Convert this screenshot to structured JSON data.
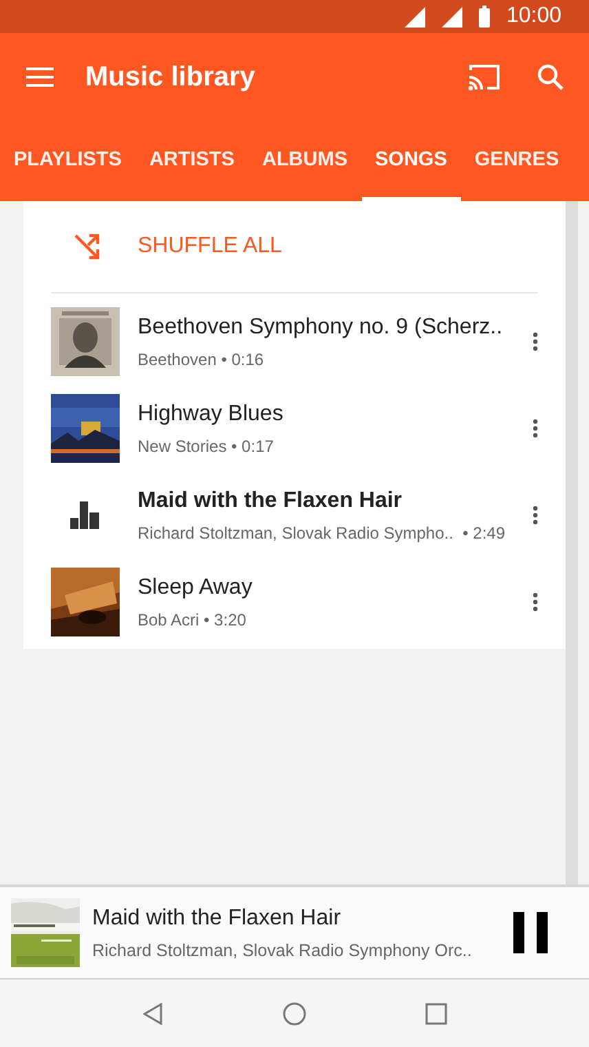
{
  "status_bar": {
    "time": "10:00"
  },
  "toolbar": {
    "title": "Music library"
  },
  "tabs": [
    {
      "label": "PLAYLISTS",
      "selected": false
    },
    {
      "label": "ARTISTS",
      "selected": false
    },
    {
      "label": "ALBUMS",
      "selected": false
    },
    {
      "label": "SONGS",
      "selected": true
    },
    {
      "label": "GENRES",
      "selected": false
    }
  ],
  "shuffle": {
    "label": "SHUFFLE ALL"
  },
  "songs": [
    {
      "title": "Beethoven Symphony no. 9 (Scherz..",
      "subtitle": "Beethoven • 0:16",
      "playing": false
    },
    {
      "title": "Highway Blues",
      "subtitle": "New Stories • 0:17",
      "playing": false
    },
    {
      "title": "Maid with the Flaxen Hair",
      "subtitle": "Richard Stoltzman, Slovak Radio Sympho..  • 2:49",
      "playing": true
    },
    {
      "title": "Sleep Away",
      "subtitle": "Bob Acri • 3:20",
      "playing": false
    }
  ],
  "now_playing": {
    "title": "Maid with the Flaxen Hair",
    "subtitle": "Richard Stoltzman, Slovak Radio Symphony Orc..",
    "playing": true
  }
}
